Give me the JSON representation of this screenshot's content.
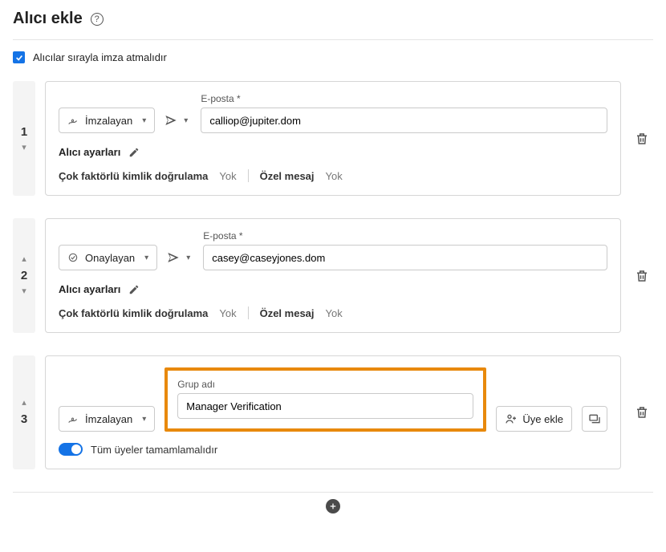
{
  "header": {
    "title": "Alıcı ekle"
  },
  "sequential": {
    "label": "Alıcılar sırayla imza atmalıdır"
  },
  "labels": {
    "email": "E-posta",
    "required_mark": "*",
    "settings": "Alıcı ayarları",
    "mfa": "Çok faktörlü kimlik doğrulama",
    "private_msg": "Özel mesaj",
    "none": "Yok",
    "group_name": "Grup adı",
    "add_member": "Üye ekle",
    "all_must_complete": "Tüm üyeler tamamlamalıdır"
  },
  "recipients": [
    {
      "order": "1",
      "role": "İmzalayan",
      "email": "calliop@jupiter.dom",
      "mfa": "Yok",
      "private_msg": "Yok"
    },
    {
      "order": "2",
      "role": "Onaylayan",
      "email": "casey@caseyjones.dom",
      "mfa": "Yok",
      "private_msg": "Yok"
    }
  ],
  "group": {
    "order": "3",
    "role": "İmzalayan",
    "name": "Manager Verification"
  }
}
